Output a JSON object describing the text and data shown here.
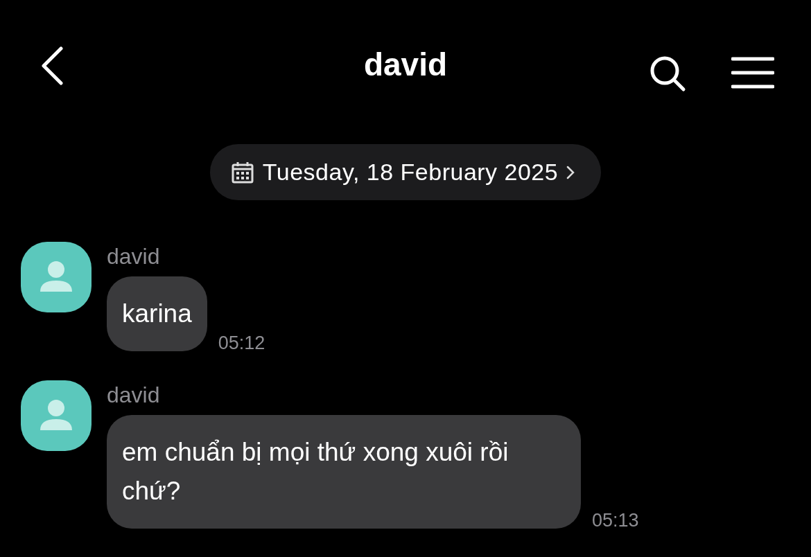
{
  "header": {
    "title": "david"
  },
  "date_chip": {
    "label": "Tuesday, 18 February 2025"
  },
  "messages": [
    {
      "sender": "david",
      "text": "karina",
      "time": "05:12"
    },
    {
      "sender": "david",
      "text": "em chuẩn bị mọi thứ xong xuôi rồi chứ?",
      "time": "05:13"
    }
  ]
}
